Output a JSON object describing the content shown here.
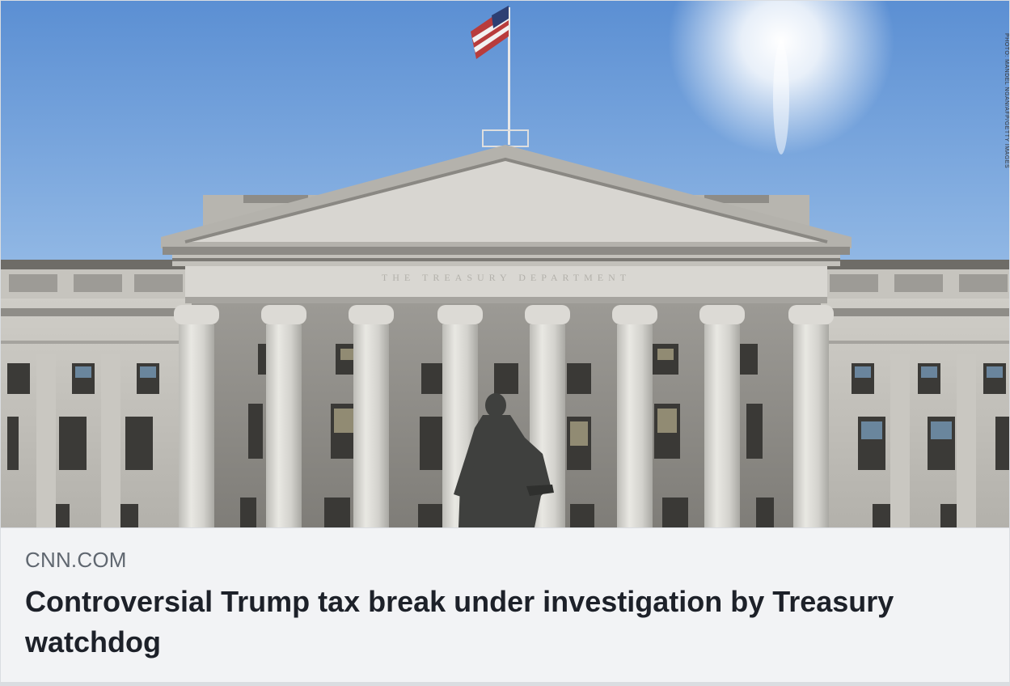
{
  "link_preview": {
    "image_alt": "Treasury Department building with statue in front",
    "image_credit": "PHOTO: MANDEL NGAN/AFP/GETTY IMAGES",
    "pediment_inscription": "THE TREASURY DEPARTMENT",
    "domain": "CNN.COM",
    "headline": "Controversial Trump tax break under investigation by Treasury watchdog"
  },
  "colors": {
    "card_background": "#f2f3f5",
    "domain_text": "#606770",
    "headline_text": "#1d2129",
    "border": "#dadde1",
    "sky_top": "#5f93d6",
    "sky_bottom": "#cfe1f2",
    "stone": "#d7d6d1"
  }
}
